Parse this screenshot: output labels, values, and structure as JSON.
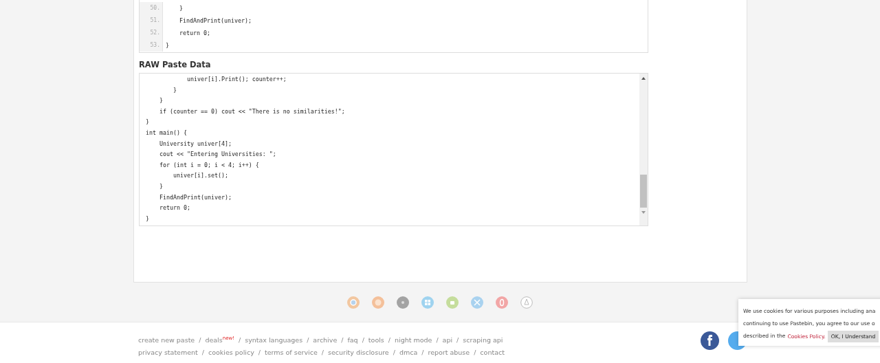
{
  "code_view": {
    "lines": [
      {
        "number": "50.",
        "text": "    }"
      },
      {
        "number": "51.",
        "text": "    FindAndPrint(univer);"
      },
      {
        "number": "52.",
        "text": "    return 0;"
      },
      {
        "number": "53.",
        "text": "}"
      }
    ]
  },
  "raw_paste": {
    "title": "RAW Paste Data",
    "lines": [
      "            univer[i].Print(); counter++;",
      "        }",
      "    }",
      "    if (counter == 0) cout << \"There is no similarities!\";",
      "}",
      "int main() {",
      "    University univer[4];",
      "    cout << \"Entering Universities: \";",
      "    for (int i = 0; i < 4; i++) {",
      "        univer[i].set();",
      "    }",
      "    FindAndPrint(univer);",
      "    return 0;",
      "}"
    ]
  },
  "footer": {
    "main_links": [
      {
        "label": "create new paste"
      },
      {
        "label": "deals",
        "badge": "new!"
      },
      {
        "label": "syntax languages"
      },
      {
        "label": "archive"
      },
      {
        "label": "faq"
      },
      {
        "label": "tools"
      },
      {
        "label": "night mode"
      },
      {
        "label": "api"
      },
      {
        "label": "scraping api"
      }
    ],
    "legal_links": [
      {
        "label": "privacy statement"
      },
      {
        "label": "cookies policy"
      },
      {
        "label": "terms of service"
      },
      {
        "label": "security disclosure"
      },
      {
        "label": "dmca"
      },
      {
        "label": "report abuse"
      },
      {
        "label": "contact"
      }
    ],
    "separator": "/"
  },
  "cookie_notice": {
    "lines": [
      "We use cookies for various purposes including ana",
      "continuing to use Pastebin, you agree to our use o"
    ],
    "last_line": "described in the",
    "link": "Cookies Policy.",
    "button": "OK, I Understand"
  }
}
